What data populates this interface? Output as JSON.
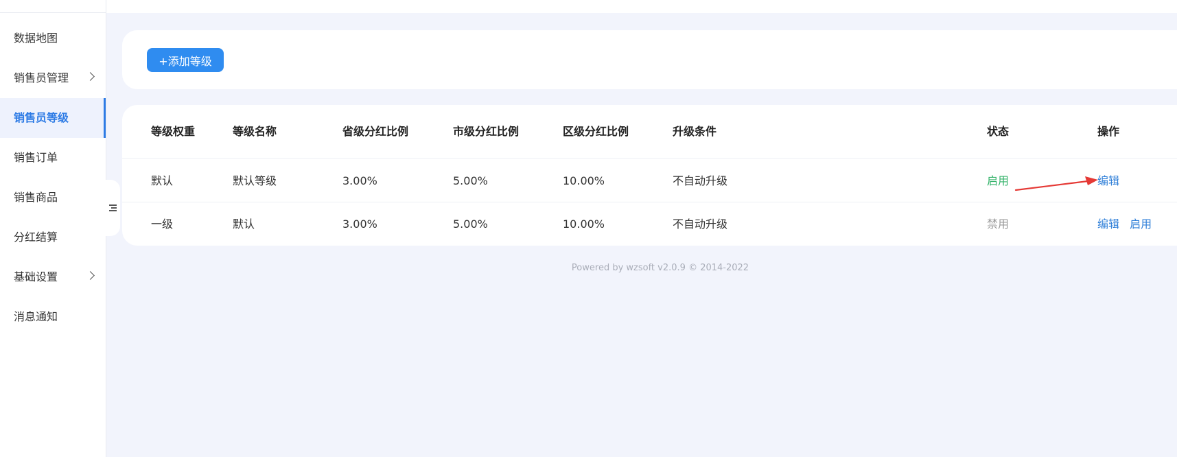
{
  "sidebar": {
    "items": [
      {
        "label": "数据地图"
      },
      {
        "label": "销售员管理"
      },
      {
        "label": "销售员等级"
      },
      {
        "label": "销售订单"
      },
      {
        "label": "销售商品"
      },
      {
        "label": "分红结算"
      },
      {
        "label": "基础设置"
      },
      {
        "label": "消息通知"
      }
    ]
  },
  "toolbar": {
    "add_label": "+添加等级"
  },
  "table": {
    "headers": [
      "等级权重",
      "等级名称",
      "省级分红比例",
      "市级分红比例",
      "区级分红比例",
      "升级条件",
      "状态",
      "操作"
    ],
    "rows": [
      {
        "weight": "默认",
        "name": "默认等级",
        "province": "3.00%",
        "city": "5.00%",
        "district": "10.00%",
        "condition": "不自动升级",
        "status": "启用",
        "status_color": "#34b36a",
        "actions": [
          "编辑"
        ]
      },
      {
        "weight": "一级",
        "name": "默认",
        "province": "3.00%",
        "city": "5.00%",
        "district": "10.00%",
        "condition": "不自动升级",
        "status": "禁用",
        "status_color": "#999999",
        "actions": [
          "编辑",
          "启用"
        ]
      }
    ]
  },
  "footer": {
    "text": "Powered by wzsoft v2.0.9 © 2014-2022"
  },
  "colors": {
    "accent": "#2d7be5",
    "button": "#2f8cf0",
    "annotation_arrow": "#e53935"
  },
  "icons": {
    "collapse": "collapse-sidebar-icon",
    "chevron": "chevron-right-icon"
  }
}
